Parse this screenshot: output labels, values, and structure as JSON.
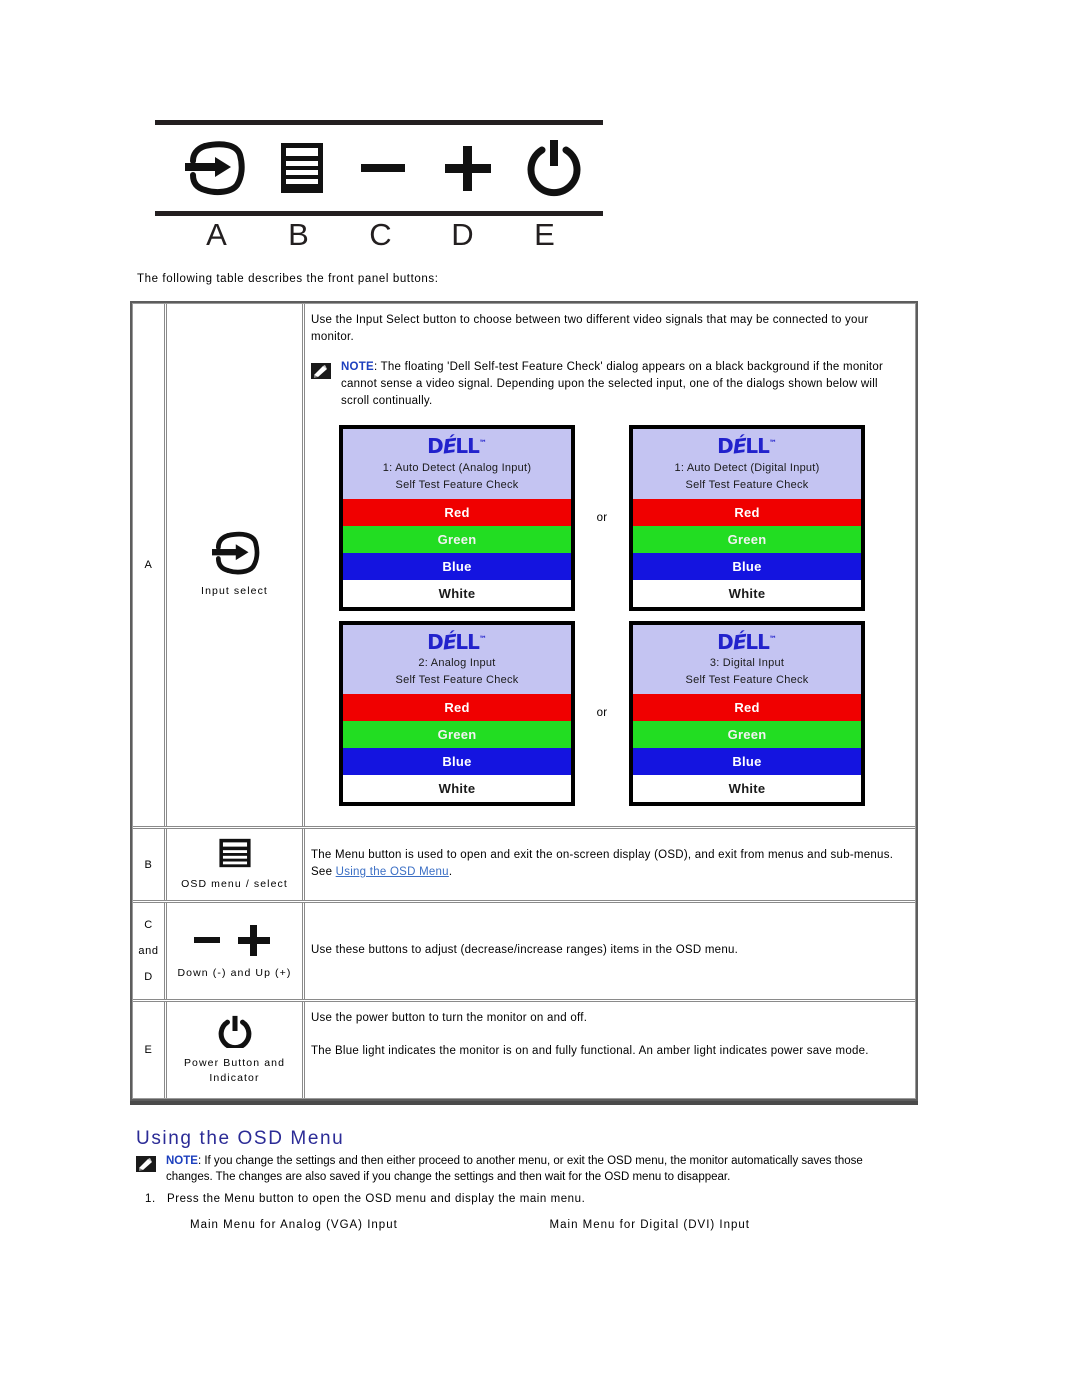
{
  "front_panel": {
    "icons": [
      {
        "name": "input-select-icon",
        "label": "A"
      },
      {
        "name": "osd-menu-icon",
        "label": "B"
      },
      {
        "name": "minus-down-icon",
        "label": "C"
      },
      {
        "name": "plus-up-icon",
        "label": "D"
      },
      {
        "name": "power-icon",
        "label": "E"
      }
    ],
    "labels": [
      "A",
      "B",
      "C",
      "D",
      "E"
    ]
  },
  "intro": "The following table describes the front panel buttons:",
  "table": {
    "rows": [
      {
        "letter": "A",
        "letter_mid": "",
        "letter_bottom": "",
        "icon": "input-select-icon",
        "caption": "Input select",
        "description": "Use the Input Select button to choose between two different video signals that may be connected to your monitor.",
        "note_word": "NOTE",
        "note_text": ": The floating 'Dell Self-test Feature Check' dialog appears on a black background if the monitor cannot sense a video signal. Depending upon the selected input, one of the dialogs shown below will scroll continually."
      },
      {
        "letter": "B",
        "icon": "osd-menu-icon",
        "caption": "OSD menu /  select",
        "description": "The Menu button is used to open and exit the on-screen display (OSD), and exit from menus and sub-menus. See ",
        "link_text": "Using the OSD Menu",
        "description_tail": "."
      },
      {
        "letter": "C",
        "letter_mid": "and",
        "letter_bottom": "D",
        "icon": "minus-plus-icon",
        "caption": "Down (-) and Up (+)",
        "description": "Use these buttons to adjust (decrease/increase ranges) items in the OSD menu."
      },
      {
        "letter": "E",
        "icon": "power-icon",
        "caption": "Power Button and Indicator",
        "description": "Use the power button to turn the monitor on and off.",
        "description2": "The Blue light indicates the monitor is on and fully functional. An amber light indicates power save mode."
      }
    ]
  },
  "dialogs": {
    "or_label": "or",
    "logo": {
      "d": "D",
      "e": "É",
      "ll": "LL",
      "tm": "™"
    },
    "bars": [
      {
        "name": "red-bar",
        "label": "Red",
        "color": "#f00000"
      },
      {
        "name": "green-bar",
        "label": "Green",
        "color": "#22dd22"
      },
      {
        "name": "blue-bar",
        "label": "Blue",
        "color": "#1414e0"
      },
      {
        "name": "white-bar",
        "label": "White",
        "color": "#ffffff"
      }
    ],
    "items": [
      {
        "title": "1: Auto Detect (Analog Input)",
        "subtitle": "Self Test  Feature Check"
      },
      {
        "title": "1: Auto Detect (Digital Input)",
        "subtitle": "Self Test  Feature Check"
      },
      {
        "title": "2: Analog Input",
        "subtitle": "Self Test  Feature Check"
      },
      {
        "title": "3: Digital Input",
        "subtitle": "Self Test  Feature Check"
      }
    ]
  },
  "osd_section": {
    "title": "Using the OSD Menu",
    "note_word": "NOTE",
    "note_text": ": If you change the settings and then either proceed to another menu, or exit the OSD menu, the monitor automatically saves those changes. The changes are also saved if you change the settings and then wait for the OSD menu to disappear.",
    "step_number": "1.",
    "step_text": "Press the Menu button to open the OSD menu and display the main menu.",
    "caption_left": "Main Menu for Analog (VGA) Input",
    "caption_right": "Main Menu for Digital (DVI) Input"
  },
  "colors": {
    "link": "#3a6ec4",
    "heading": "#2b2b96",
    "note_word": "#1c3fbe",
    "dell_blue": "#2222cc",
    "dialog_header": "#c4c4f2"
  }
}
